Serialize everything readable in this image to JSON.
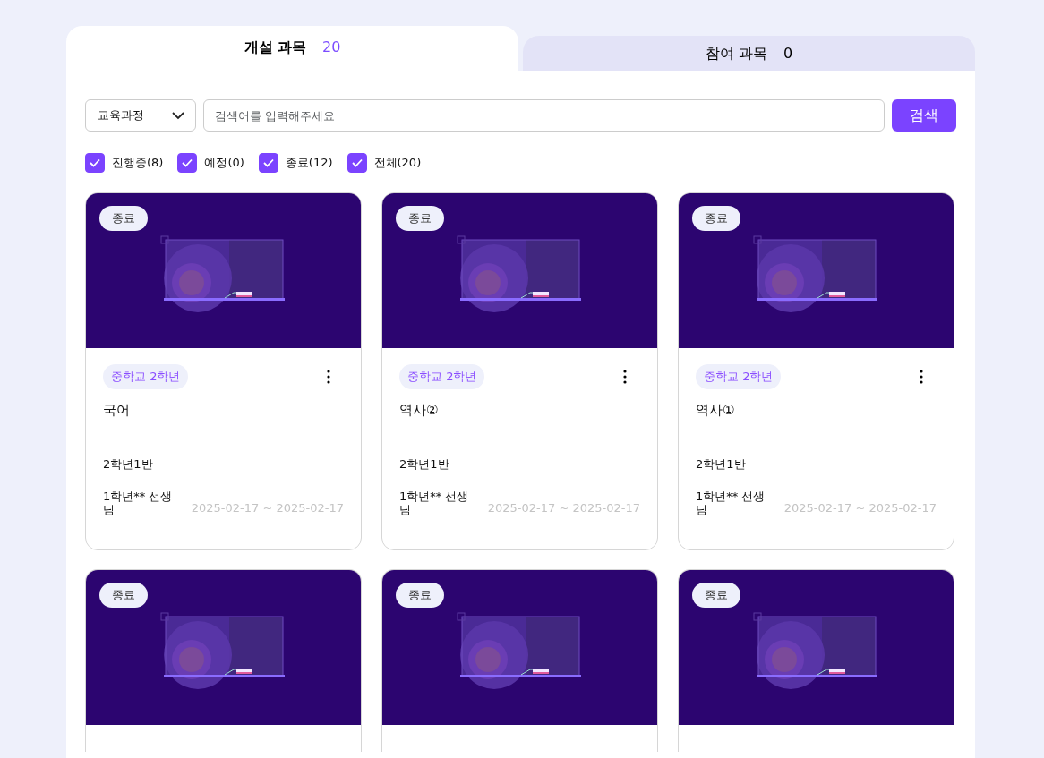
{
  "tabs": [
    {
      "label": "개설 과목",
      "count": "20",
      "selected": true
    },
    {
      "label": "참여 과목",
      "count": "0",
      "selected": false
    }
  ],
  "search": {
    "select": "교육과정",
    "placeholder": "검색어를 입력해주세요",
    "button": "검색"
  },
  "filters": [
    {
      "label": "진행중(8)",
      "checked": true
    },
    {
      "label": "예정(0)",
      "checked": true
    },
    {
      "label": "종료(12)",
      "checked": true
    },
    {
      "label": "전체(20)",
      "checked": true
    }
  ],
  "courses": [
    {
      "status": "종료",
      "grade": "중학교 2학년",
      "title": "국어",
      "class": "2학년1반",
      "teacher": "1학년** 선생님",
      "period": "2025-02-17 ~ 2025-02-17"
    },
    {
      "status": "종료",
      "grade": "중학교 2학년",
      "title": "역사②",
      "class": "2학년1반",
      "teacher": "1학년** 선생님",
      "period": "2025-02-17 ~ 2025-02-17"
    },
    {
      "status": "종료",
      "grade": "중학교 2학년",
      "title": "역사①",
      "class": "2학년1반",
      "teacher": "1학년** 선생님",
      "period": "2025-02-17 ~ 2025-02-17"
    },
    {
      "status": "종료"
    },
    {
      "status": "종료"
    },
    {
      "status": "종료"
    }
  ]
}
